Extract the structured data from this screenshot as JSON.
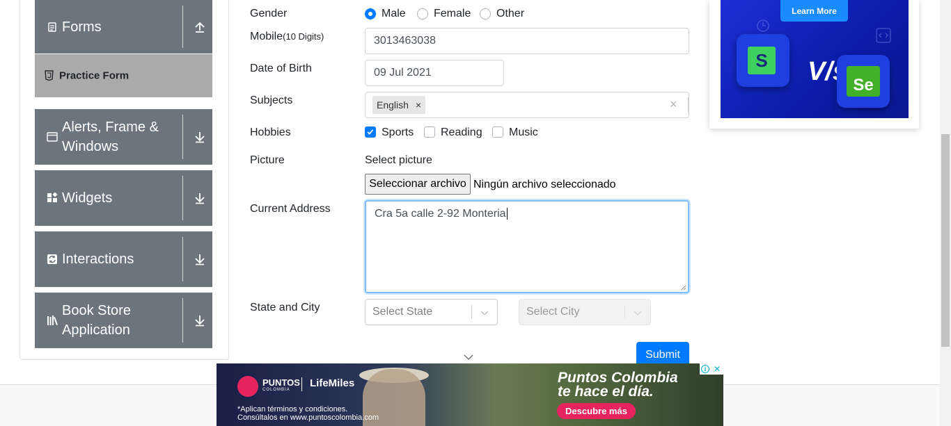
{
  "sidebar": {
    "groups": [
      {
        "label": "Forms",
        "icon": "form-icon",
        "toggle": "collapse-up-icon"
      },
      {
        "label": "Alerts, Frame & Windows",
        "icon": "window-icon",
        "toggle": "expand-down-icon"
      },
      {
        "label": "Widgets",
        "icon": "widgets-icon",
        "toggle": "expand-down-icon"
      },
      {
        "label": "Interactions",
        "icon": "interactions-icon",
        "toggle": "expand-down-icon"
      },
      {
        "label": "Book Store Application",
        "icon": "books-icon",
        "toggle": "expand-down-icon"
      }
    ],
    "active_item": {
      "label": "Practice Form",
      "icon": "html-icon"
    }
  },
  "form": {
    "gender": {
      "label": "Gender",
      "options": [
        "Male",
        "Female",
        "Other"
      ],
      "selected": "Male"
    },
    "mobile": {
      "label": "Mobile",
      "hint": "(10 Digits)",
      "value": "3013463038"
    },
    "dob": {
      "label": "Date of Birth",
      "value": "09 Jul 2021"
    },
    "subjects": {
      "label": "Subjects",
      "chips": [
        "English"
      ],
      "chip_remove": "×",
      "clear": "×"
    },
    "hobbies": {
      "label": "Hobbies",
      "options": [
        {
          "label": "Sports",
          "checked": true
        },
        {
          "label": "Reading",
          "checked": false
        },
        {
          "label": "Music",
          "checked": false
        }
      ]
    },
    "picture": {
      "label": "Picture",
      "prompt": "Select picture",
      "button": "Seleccionar archivo",
      "status": "Ningún archivo seleccionado"
    },
    "address": {
      "label": "Current Address",
      "value": "Cra 5a calle 2-92 Monteria"
    },
    "state_city": {
      "label": "State and City",
      "state_placeholder": "Select State",
      "city_placeholder": "Select City"
    },
    "submit_label": "Submit"
  },
  "right_ad": {
    "cta": "Learn More",
    "vs_text": "V/s",
    "left_logo": "S",
    "right_logo": "Se"
  },
  "bottom_ad": {
    "brand_primary": "PUNTOS",
    "brand_primary_sub": "COLOMBIA",
    "brand_secondary": "LifeMiles",
    "legal_line1": "*Aplican términos y condiciones.",
    "legal_line2": "Consúltalos en www.puntoscolombia.com",
    "headline_line1": "Puntos Colombia",
    "headline_line2": "te hace el día.",
    "cta": "Descubre más",
    "close_glyph": "✕",
    "info_glyph": "i"
  },
  "colors": {
    "sidebar_group": "#6c757d",
    "sidebar_active": "#aaaaaa",
    "primary": "#007bff",
    "ad_pink": "#e8245e"
  }
}
